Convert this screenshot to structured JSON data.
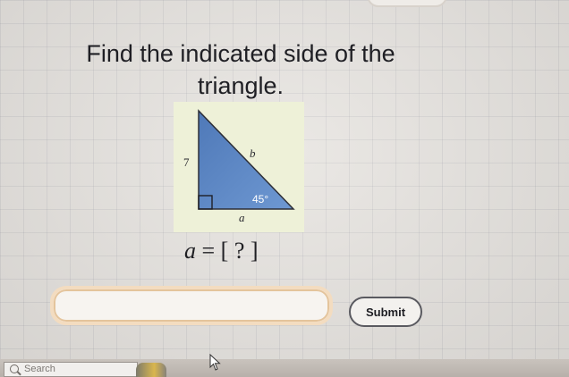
{
  "question": {
    "line1": "Find the indicated side of the",
    "line2": "triangle."
  },
  "figure": {
    "side_left": "7",
    "side_hyp": "b",
    "side_bottom": "a",
    "angle": "45°"
  },
  "equation": {
    "variable": "a",
    "equals": " = ",
    "placeholder": "[ ? ]"
  },
  "answer": {
    "value": "",
    "placeholder": ""
  },
  "submit": {
    "label": "Submit"
  },
  "taskbar": {
    "search_label": "Search",
    "search_icon": "search-icon"
  },
  "colors": {
    "figure_bg": "#eef1d8",
    "triangle_fill": "#5b86c4",
    "field_border": "#f3dcc0"
  }
}
